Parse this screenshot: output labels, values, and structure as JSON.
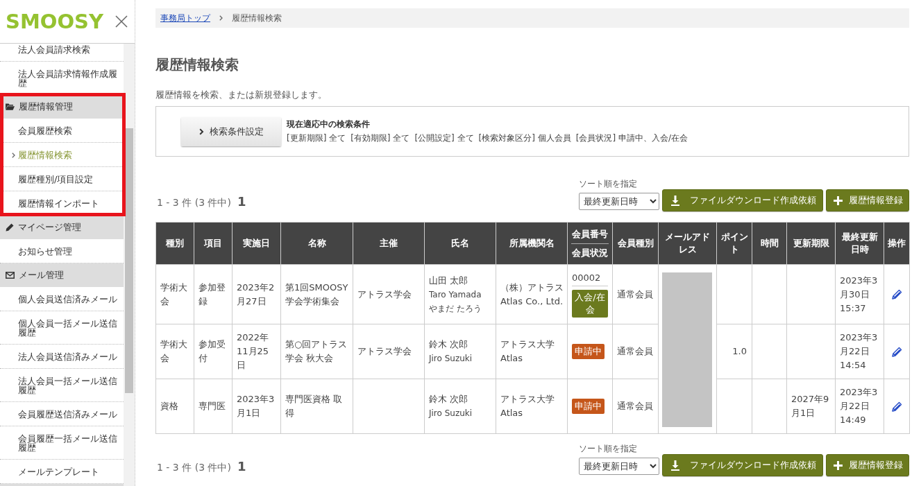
{
  "sidebar": {
    "logo": "SMOOSY",
    "items": [
      {
        "label": "法人会員請求検索",
        "selected": false
      },
      {
        "label": "法人会員請求情報作成履歴",
        "selected": false
      }
    ],
    "groups": [
      {
        "label": "履歴情報管理",
        "highlighted": true,
        "items": [
          {
            "label": "会員履歴検索",
            "selected": false
          },
          {
            "label": "履歴情報検索",
            "selected": true
          },
          {
            "label": "履歴種別/項目設定",
            "selected": false
          },
          {
            "label": "履歴情報インポート",
            "selected": false
          }
        ]
      },
      {
        "label": "マイページ管理",
        "highlighted": false,
        "items": [
          {
            "label": "お知らせ管理",
            "selected": false
          }
        ]
      },
      {
        "label": "メール管理",
        "highlighted": false,
        "items": [
          {
            "label": "個人会員送信済みメール",
            "selected": false
          },
          {
            "label": "個人会員一括メール送信履歴",
            "selected": false
          },
          {
            "label": "法人会員送信済みメール",
            "selected": false
          },
          {
            "label": "法人会員一括メール送信履歴",
            "selected": false
          },
          {
            "label": "会員履歴送信済みメール",
            "selected": false
          },
          {
            "label": "会員履歴一括メール送信履歴",
            "selected": false
          },
          {
            "label": "メールテンプレート",
            "selected": false
          }
        ]
      }
    ]
  },
  "breadcrumb": [
    {
      "label": "事務局トップ",
      "kind": "link"
    },
    {
      "label": "履歴情報検索",
      "kind": "current"
    }
  ],
  "header": {
    "title": "履歴情報検索",
    "description": "履歴情報を検索、または新規登録します。"
  },
  "search_panel": {
    "button": "検索条件設定",
    "caption": "現在適応中の検索条件",
    "conditions": [
      "[更新期限] 全て",
      "[有効期限] 全て",
      "[公開設定] 全て",
      "[検索対象区分] 個人会員",
      "[会員状況] 申請中、入会/在会"
    ]
  },
  "toolbar_top": {
    "count": "1 - 3 件 (3 件中)",
    "current_page": "1",
    "sort_label": "ソート順を指定",
    "sort_value": "最終更新日時",
    "buttons": [
      {
        "kind": "download",
        "label": "ファイルダウンロード作成依頼"
      },
      {
        "kind": "add",
        "label": "履歴情報登録"
      }
    ]
  },
  "table": {
    "columns": [
      {
        "labels": [
          "種別"
        ]
      },
      {
        "labels": [
          "項目"
        ]
      },
      {
        "labels": [
          "実施日"
        ]
      },
      {
        "labels": [
          "名称"
        ]
      },
      {
        "labels": [
          "主催"
        ]
      },
      {
        "labels": [
          "氏名"
        ]
      },
      {
        "labels": [
          "所属機関名"
        ]
      },
      {
        "labels": [
          "会員番号",
          "会員状況"
        ]
      },
      {
        "labels": [
          "会員種別"
        ]
      },
      {
        "labels": [
          "メールアドレス"
        ]
      },
      {
        "labels": [
          "ポイント"
        ]
      },
      {
        "labels": [
          "時間"
        ]
      },
      {
        "labels": [
          "更新期限"
        ]
      },
      {
        "labels": [
          "最終更新日時"
        ]
      },
      {
        "labels": [
          "操作"
        ]
      }
    ],
    "rows": [
      {
        "category": "学術大会",
        "item": "参加登録",
        "date": "2023年2月27日",
        "title": "第1回SMOOSY学会学術集会",
        "organizer": "アトラス学会",
        "person": {
          "name": "山田 太郎",
          "name_en": "Taro Yamada",
          "kana": "やまだ たろう"
        },
        "affiliation": {
          "name": "（株）アトラス",
          "name_en": "Atlas Co., Ltd."
        },
        "member_no": "00002",
        "status": {
          "label": "入会/在会",
          "color": "#6b7a1e"
        },
        "member_type": "通常会員",
        "updated": "2023年3月30日 15:37"
      },
      {
        "category": "学術大会",
        "item": "参加受付",
        "date": "2022年11月25日",
        "title": "第○回アトラス学会 秋大会",
        "organizer": "アトラス学会",
        "person": {
          "name": "鈴木 次郎",
          "name_en": "Jiro Suzuki"
        },
        "affiliation": {
          "name": "アトラス大学",
          "name_en": "Atlas"
        },
        "status": {
          "label": "申請中",
          "color": "#c5561a"
        },
        "member_type": "通常会員",
        "points": "1.0",
        "updated": "2023年3月22日 14:54"
      },
      {
        "category": "資格",
        "item": "専門医",
        "date": "2023年3月1日",
        "title": "専門医資格 取得",
        "person": {
          "name": "鈴木 次郎",
          "name_en": "Jiro Suzuki"
        },
        "affiliation": {
          "name": "アトラス大学",
          "name_en": "Atlas"
        },
        "status": {
          "label": "申請中",
          "color": "#c5561a"
        },
        "member_type": "通常会員",
        "renewal_deadline": "2027年9月1日",
        "updated": "2023年3月22日 14:49"
      }
    ]
  },
  "toolbar_bottom": {
    "count": "1 - 3 件 (3 件中)",
    "current_page": "1",
    "sort_label": "ソート順を指定",
    "sort_value": "最終更新日時",
    "buttons": [
      {
        "kind": "download",
        "label": "ファイルダウンロード作成依頼"
      },
      {
        "kind": "add",
        "label": "履歴情報登録"
      }
    ]
  }
}
